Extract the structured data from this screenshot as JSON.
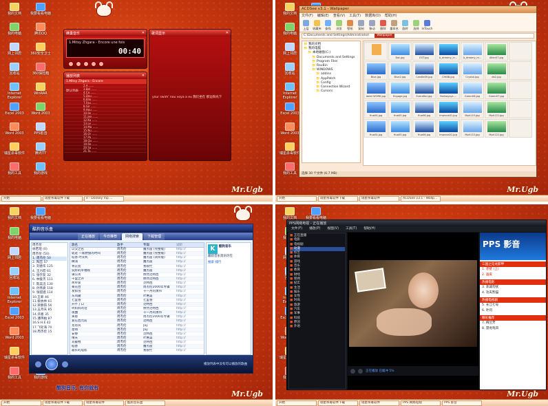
{
  "desktop": {
    "icons": [
      "我的文档",
      "我要看看电脑",
      "我的电脑",
      "腾讯QQ",
      "网上邻居",
      "360安全卫士",
      "回收站",
      "360保险箱",
      "Internet Explorer",
      "WinRAR",
      "Excel 2003",
      "Word 2003",
      "Word 2003",
      "PPS影音",
      "瑞星杀毒软件",
      "腾讯TT",
      "我的工具",
      "我的游戏"
    ],
    "logo": "Mr.Ugb"
  },
  "taskbars": [
    [
      "瑞星杀毒软件下载",
      "e - Donkey Vip ...",
      "",
      ""
    ],
    [
      "瑞星杀毒软件下载",
      "瑞星杀毒软件",
      "ACDSee v3.1 - Wallp...",
      ""
    ],
    [
      "瑞星杀毒软件下载",
      "瑞星杀毒软件",
      "酷狗音乐盒",
      ""
    ],
    [
      "瑞星杀毒软件下载",
      "瑞星杀毒软件",
      "PPS 网络电视",
      "PPS 影音"
    ]
  ],
  "player": {
    "title": "蜂巢音乐",
    "song": "1.Mitsy Zhgara - Encore une fois",
    "time": "00:40",
    "lyrics_title": "歌词显示",
    "lyrics": "your swim'  nou voya a eu  我们坐在 那边阳光下 ",
    "playlist_title": "播放列表",
    "playlist_side": "默认列表",
    "playlist_header": "1.Mitsy Zhgara - Encore",
    "tracks": [
      "2.A ......",
      "3.Bel ......",
      "4.Ca ......",
      "5.Dou ......",
      "6.Elle ......",
      "7.Fou ......",
      "8.Gir ......",
      "9.Hou ......",
      "10.Ile ......",
      "11.Jen ......",
      "12.Ka ......",
      "13.Le ......",
      "14.Mo ......",
      "15.Nu ......",
      "16.Or ......",
      "17.Pa ......",
      "18.Qu ......",
      "19.Re ......",
      "20.Sa ......",
      "21.Ta ......"
    ]
  },
  "acdsee": {
    "title": "ACDSee v3.1 - Wallpaper",
    "menu": [
      "文件(F)",
      "编辑(E)",
      "查看(V)",
      "工具(T)",
      "数据库(D)",
      "帮助(H)"
    ],
    "tools": [
      "上层",
      "收藏夹",
      "查找",
      "浏览",
      "壁纸",
      "复制",
      "移动",
      "删除",
      "重命名",
      "旋转",
      "选择",
      "InTouch"
    ],
    "address": "C:\\Documents and Settings\\Administrator\\",
    "address_folder": "Wallpaper",
    "tree": [
      "我的文档",
      "我的电脑",
      "本地磁盘(C:)",
      "Documents and Settings",
      "Program Files",
      "RavBin",
      "WINDOWS",
      "addins",
      "AppPatch",
      "Config",
      "Connection Wizard",
      "Cursors"
    ],
    "thumbs": [
      [
        "(folder)",
        ""
      ],
      [
        "1024x768x24b",
        "Dot.jpg"
      ],
      [
        "1024x768x24b",
        "EGT.jpg"
      ],
      [
        "1024x768x24b",
        "A_dreamy_in..."
      ],
      [
        "1024x768x24b",
        "A_dreamy_m..."
      ],
      [
        "1024x768x24b",
        "Allen07.jpg"
      ],
      [
        "",
        ""
      ],
      [
        "800x600x24b",
        "Blue.jpg"
      ],
      [
        "800x600x24b",
        "Blue2.jpg"
      ],
      [
        "1024x768x24b",
        "Candle09.jpg"
      ],
      [
        "1024x768x24b",
        "CHIBB.jpg"
      ],
      [
        "1024x768x24b",
        "Crystal.jpg"
      ],
      [
        "1024x768x24b",
        "db2.jpg"
      ],
      [
        "",
        ""
      ],
      [
        "1024x768x24b",
        "dolet WORK.jpg"
      ],
      [
        "1024x768x24b",
        "Engage.jpg"
      ],
      [
        "1024x768x24b",
        "Everafter.jpg"
      ],
      [
        "1024x768x24b",
        "Fantasysys...."
      ],
      [
        "1024x768x24b",
        "Green06.jpg"
      ],
      [
        "1024x768x24b",
        "Green07.jpg"
      ],
      [
        "",
        ""
      ],
      [
        "1024x1280x24b",
        "Hua04.jpg"
      ],
      [
        "1024x1280x24b",
        "Hua05.jpg"
      ],
      [
        "1024x1280x24b",
        "Hua06.jpg"
      ],
      [
        "1024x768x24b",
        "Improvs01.jpg"
      ],
      [
        "1024x768x24b",
        "Mph115.jpg"
      ],
      [
        "1024x768x24b",
        "Mph122.jpg"
      ],
      [
        "",
        ""
      ],
      [
        "1024x768x24b",
        "Hua04.jpg"
      ],
      [
        "1024x768x24b",
        "Hua05.jpg"
      ],
      [
        "1024x768x24b",
        "Hua06.jpg"
      ],
      [
        "1024x768x24b",
        "Improvs01.jpg"
      ],
      [
        "1024x768x24b",
        "Mph115.jpg"
      ],
      [
        "1024x768x24b",
        "Mph122.jpg"
      ],
      [
        "",
        ""
      ]
    ],
    "status": "选择 30 个文件 (6.7 MB)"
  },
  "music": {
    "title": "酷狗音乐盒",
    "tabs": [
      "正在播放",
      "今日推荐",
      "网络搜索",
      "下载管理"
    ],
    "left": [
      [
        "周杰伦",
        ""
      ],
      [
        "徐若瑄",
        "(0)"
      ],
      [
        "周杰伦",
        "(50)"
      ],
      [
        "1. 周杰伦",
        "50"
      ],
      [
        "2. 陶喆",
        "57"
      ],
      [
        "3. 刘德华",
        "125"
      ],
      [
        "4. 王力宏",
        "61"
      ],
      [
        "5. 张学友",
        "32"
      ],
      [
        "6. 林俊杰",
        "111"
      ],
      [
        "7. 陈奕迅",
        "130"
      ],
      [
        "8. 孙燕姿",
        "118"
      ],
      [
        "9. 张韶涵",
        "114"
      ],
      [
        "10.王菲",
        "46"
      ],
      [
        "11.蔡依林",
        "61"
      ],
      [
        "12.梁静茹",
        "56"
      ],
      [
        "13.五月天",
        "85"
      ],
      [
        "14.许嵩",
        "35"
      ],
      [
        "15.潘玮柏",
        "87"
      ],
      [
        "16.S.H.E",
        "42"
      ],
      [
        "17.飞轮海",
        "70"
      ],
      [
        "18.周杰伦",
        "15"
      ]
    ],
    "header": [
      "歌名",
      "歌手",
      "专辑",
      "试听"
    ],
    "rows": [
      [
        "以父之名",
        "周杰伦",
        "魔杰座 (完整版)",
        "http://"
      ],
      [
        "轨迹 一家野狼的时间",
        "周杰伦",
        "魔杰座 (完整版)",
        "http://"
      ],
      [
        "稻香 时光机",
        "周杰伦",
        "魔杰座 (试听版)",
        "http://"
      ],
      [
        "搁浅",
        "周杰伦",
        "魔杰座",
        "http://"
      ],
      [
        "青花瓷",
        "周杰伦",
        "我很忙",
        "http://"
      ],
      [
        "说好的幸福呢",
        "周杰伦",
        "魔杰座",
        "http://"
      ],
      [
        "蒲公英",
        "周杰伦",
        "依然范特西",
        "http://"
      ],
      [
        "千里之外",
        "周杰伦",
        "依然范特西",
        "http://"
      ],
      [
        "简单爱",
        "周杰伦",
        "范特西",
        "http://"
      ],
      [
        "菊花台",
        "周杰伦",
        "周杰伦2006年专辑",
        "http://"
      ],
      [
        "发如雪",
        "周杰伦",
        "十一月的萧邦",
        "http://"
      ],
      [
        "东风破",
        "周杰伦",
        "叶惠美",
        "http://"
      ],
      [
        "七里香",
        "周杰伦",
        "七里香",
        "http://"
      ],
      [
        "开不了口",
        "周杰伦",
        "范特西",
        "http://"
      ],
      [
        "听妈妈的话",
        "周杰伦",
        "依然范特西",
        "http://"
      ],
      [
        "夜曲",
        "周杰伦",
        "十一月的萧邦",
        "http://"
      ],
      [
        "黄昏",
        "周杰伦",
        "周杰伦2006年专辑",
        "http://"
      ],
      [
        "爱在西元前",
        "周杰伦",
        "范特西",
        "http://"
      ],
      [
        "龙卷风",
        "周杰伦",
        "Jay",
        "http://"
      ],
      [
        "星晴",
        "周杰伦",
        "Jay",
        "http://"
      ],
      [
        "安静",
        "周杰伦",
        "范特西",
        "http://"
      ],
      [
        "晴天",
        "周杰伦",
        "叶惠美",
        "http://"
      ],
      [
        "双截棍",
        "周杰伦",
        "范特西",
        "http://"
      ],
      [
        "稻香",
        "周杰伦",
        "魔杰座",
        "http://"
      ],
      [
        "最长的电影",
        "周杰伦",
        "我很忙",
        "http://"
      ]
    ],
    "right_title": "酷狗音乐",
    "right_text": "最新音乐资讯尽在",
    "right_links": [
      "搜索",
      "排行"
    ],
    "status": "播放列表中没有可以播放的歌曲",
    "slogan": "酷狗音乐, 有你就有"
  },
  "pps": {
    "title": "PPS网络电视 - 正在播放",
    "menu": [
      "文件(F)",
      "播放(P)",
      "视图(V)",
      "工具(T)",
      "帮助(H)"
    ],
    "left": [
      "正在直播",
      "电影",
      "电视剧",
      "动漫",
      "综艺",
      "体育",
      "游戏",
      "音乐",
      "教育",
      "财经",
      "新闻",
      "纪实",
      "生活",
      "娱乐",
      "女性",
      "时尚",
      "旅游",
      "汽车",
      "军事",
      "科技",
      "原创",
      "外语"
    ],
    "left_selected": "动漫",
    "video_status": "正在播放 已缓冲 5%",
    "ad": "PPS 影音",
    "sections": [
      "三国之见龙卸甲",
      "热播电影",
      "热播电视剧",
      "精彩推荐"
    ],
    "lines": [
      "1. 赤壁 (上)",
      "2. 画皮",
      "3. 非诚勿扰",
      "4. 功夫熊猫",
      "5. 长江七号",
      "6. 叶问",
      "7. 梅兰芳",
      "8. 游龙戏凤"
    ]
  }
}
